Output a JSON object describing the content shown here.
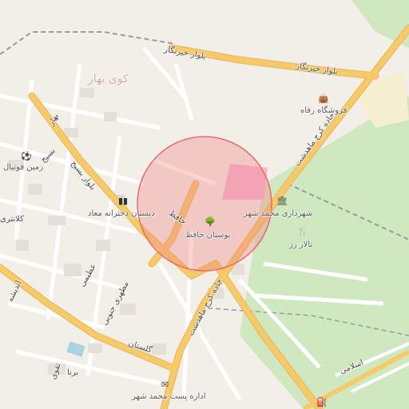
{
  "labels": {
    "district": "کوی بهار",
    "blvd_bahar": "بهار",
    "blvd_kheirangar_1": "بلوار خیرنگار",
    "blvd_kheirangar_2": "بلوار خیرنگار",
    "blvd_basij_1": "بسیج",
    "blvd_basij_2": "بلوار بسیج",
    "karaj_mahdasht_1": "جاده کرج ماهدشت",
    "karaj_mahdasht_2": "جاده کرج ماهدشت",
    "hafez_street": "حافظ",
    "azimi": "عظیمی",
    "motahari_south": "مطهری جنوبی",
    "golestan": "گلستان",
    "andisheh": "اندیشه",
    "taghavi": "تقوی",
    "islami": "اسلامی",
    "kalantari": "کلانتری",
    "barna": "برنا",
    "sports_field": "زمین فوتبال",
    "girls_school": "دبستان دخترانه معاد",
    "municipality": "شهرداری محمد شهر",
    "refah_store": "فروشگاه رفاه",
    "hall_roz": "تالار رز",
    "hafez_park": "بوستان حافظ",
    "post_office": "اداره پست محمد شهر"
  },
  "icons": {
    "sports": "⚽",
    "school": "▮▮",
    "municipality": "🏛",
    "store": "👜",
    "hall": "🍴",
    "park": "🌳",
    "post": "✉",
    "fuel": "⛽"
  },
  "colors": {
    "background": "#f2efe9",
    "green_area": "#cfe8c0",
    "major_road": "#f6ca68",
    "minor_road": "#ffffff",
    "pink_area": "#f6b6d1",
    "highlight_circle": "#e86a6a"
  }
}
